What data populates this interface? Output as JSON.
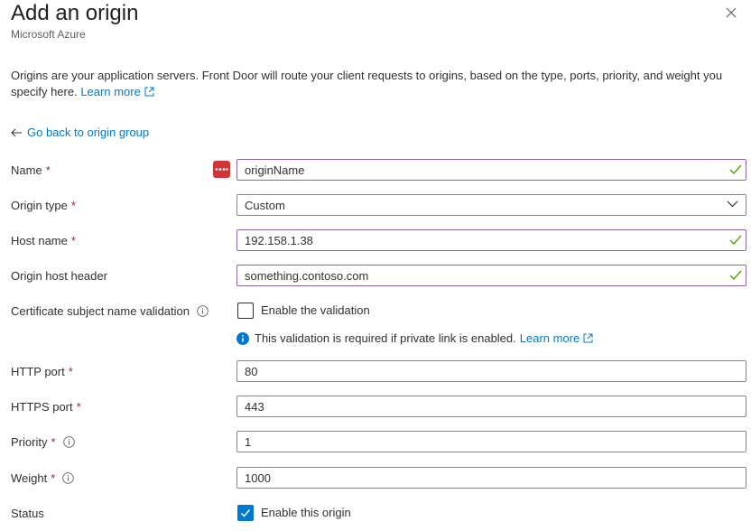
{
  "header": {
    "title": "Add an origin",
    "subtitle": "Microsoft Azure",
    "close_icon": "close-icon"
  },
  "description": {
    "text": "Origins are your application servers. Front Door will route your client requests to origins, based on the type, ports, priority, and weight you specify here.",
    "link": "Learn more"
  },
  "back_link": "Go back to origin group",
  "form": {
    "name": {
      "label": "Name",
      "value": "originName"
    },
    "origin_type": {
      "label": "Origin type",
      "value": "Custom"
    },
    "host_name": {
      "label": "Host name",
      "value": "192.158.1.38"
    },
    "origin_host_header": {
      "label": "Origin host header",
      "value": "something.contoso.com"
    },
    "cert_validation": {
      "label": "Certificate subject name validation",
      "checkbox_label": "Enable the validation",
      "checked": false,
      "note": "This validation is required if private link is enabled.",
      "note_link": "Learn more"
    },
    "http_port": {
      "label": "HTTP port",
      "value": "80"
    },
    "https_port": {
      "label": "HTTPS port",
      "value": "443"
    },
    "priority": {
      "label": "Priority",
      "value": "1"
    },
    "weight": {
      "label": "Weight",
      "value": "1000"
    },
    "status": {
      "label": "Status",
      "checkbox_label": "Enable this origin",
      "checked": true
    }
  },
  "required_marker": "*",
  "colors": {
    "link": "#0078d4",
    "required": "#a4262c",
    "valid_border": "#8764b8",
    "valid_check": "#57a300",
    "password_badge": "#d13438"
  }
}
